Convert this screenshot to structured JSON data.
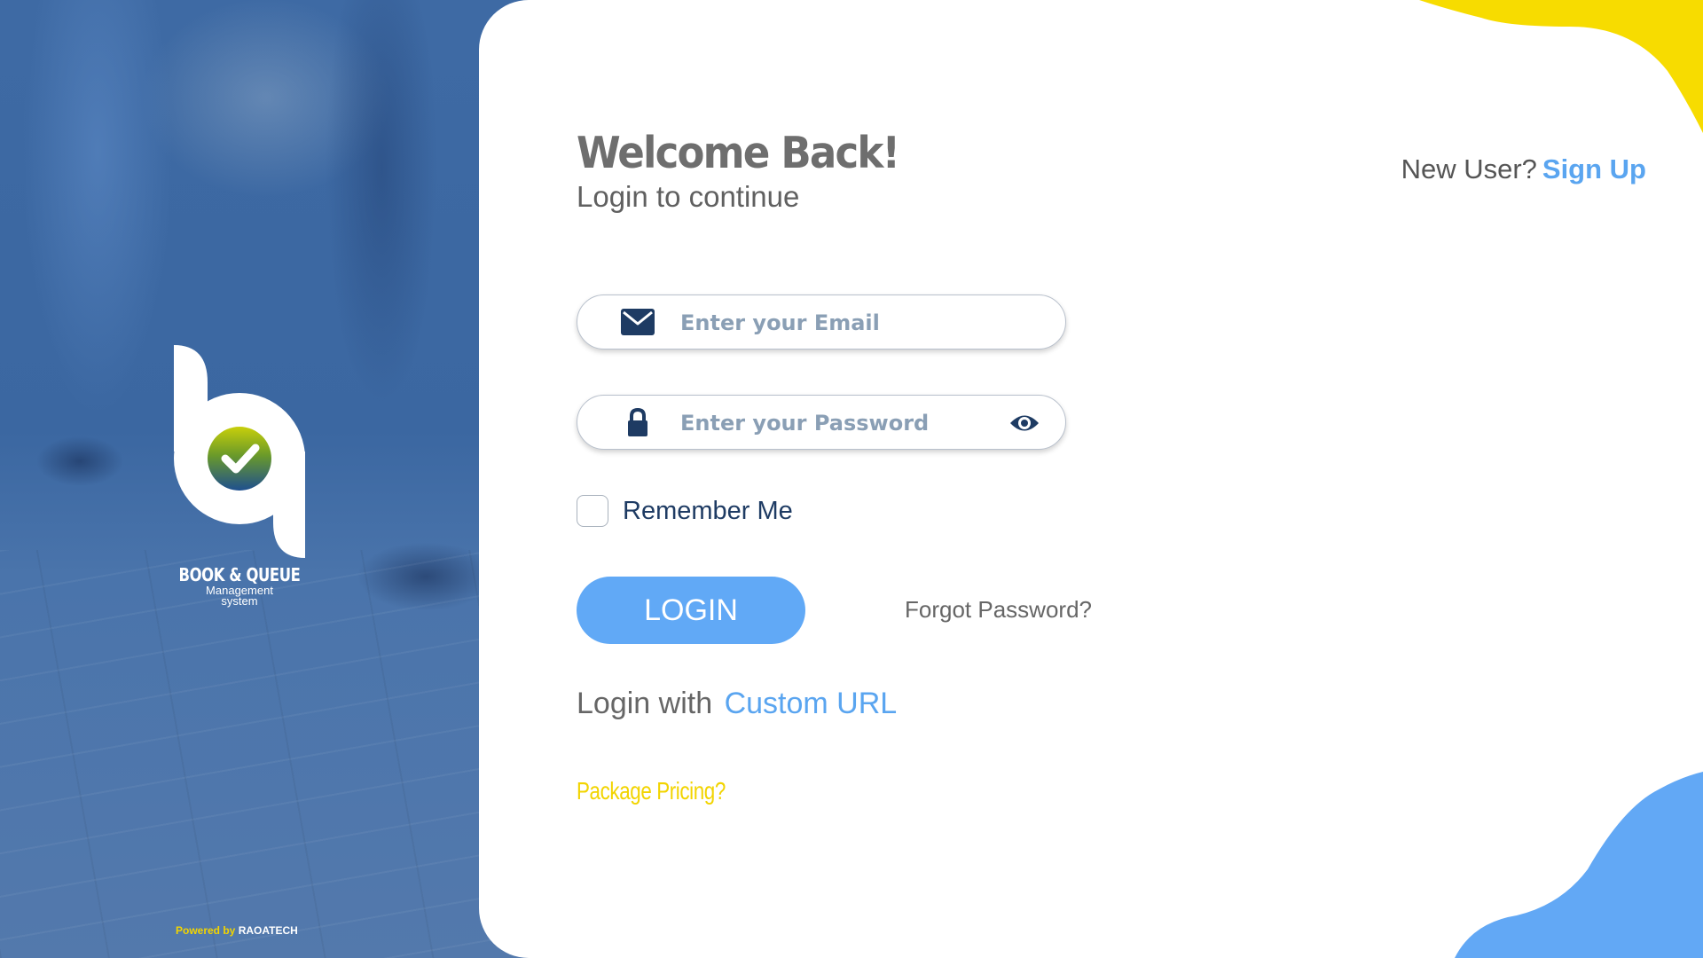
{
  "brand": {
    "name": "BOOK & QUEUE",
    "subtitle_line1": "Management",
    "subtitle_line2": "system",
    "powered_prefix": "Powered by",
    "powered_company": "RAOATECH"
  },
  "header": {
    "title": "Welcome Back!",
    "subtitle": "Login to continue",
    "new_user_text": "New User?",
    "signup_label": "Sign Up"
  },
  "form": {
    "email_placeholder": "Enter your Email",
    "password_placeholder": "Enter your Password",
    "remember_label": "Remember Me",
    "remember_checked": false,
    "login_label": "LOGIN",
    "forgot_label": "Forgot Password?",
    "custom_prefix": "Login with",
    "custom_link": "Custom URL",
    "pricing_label": "Package Pricing?"
  },
  "icons": {
    "email": "envelope-icon",
    "password": "lock-icon",
    "reveal": "eye-icon",
    "logo": "checkmark-badge-icon"
  },
  "colors": {
    "panel_blue": "#3f6aa3",
    "accent_blue": "#61a9f6",
    "link_blue": "#5aa5f0",
    "yellow": "#f2d400",
    "icon_navy": "#1e3b63",
    "title_gray": "#6e6e6e"
  }
}
